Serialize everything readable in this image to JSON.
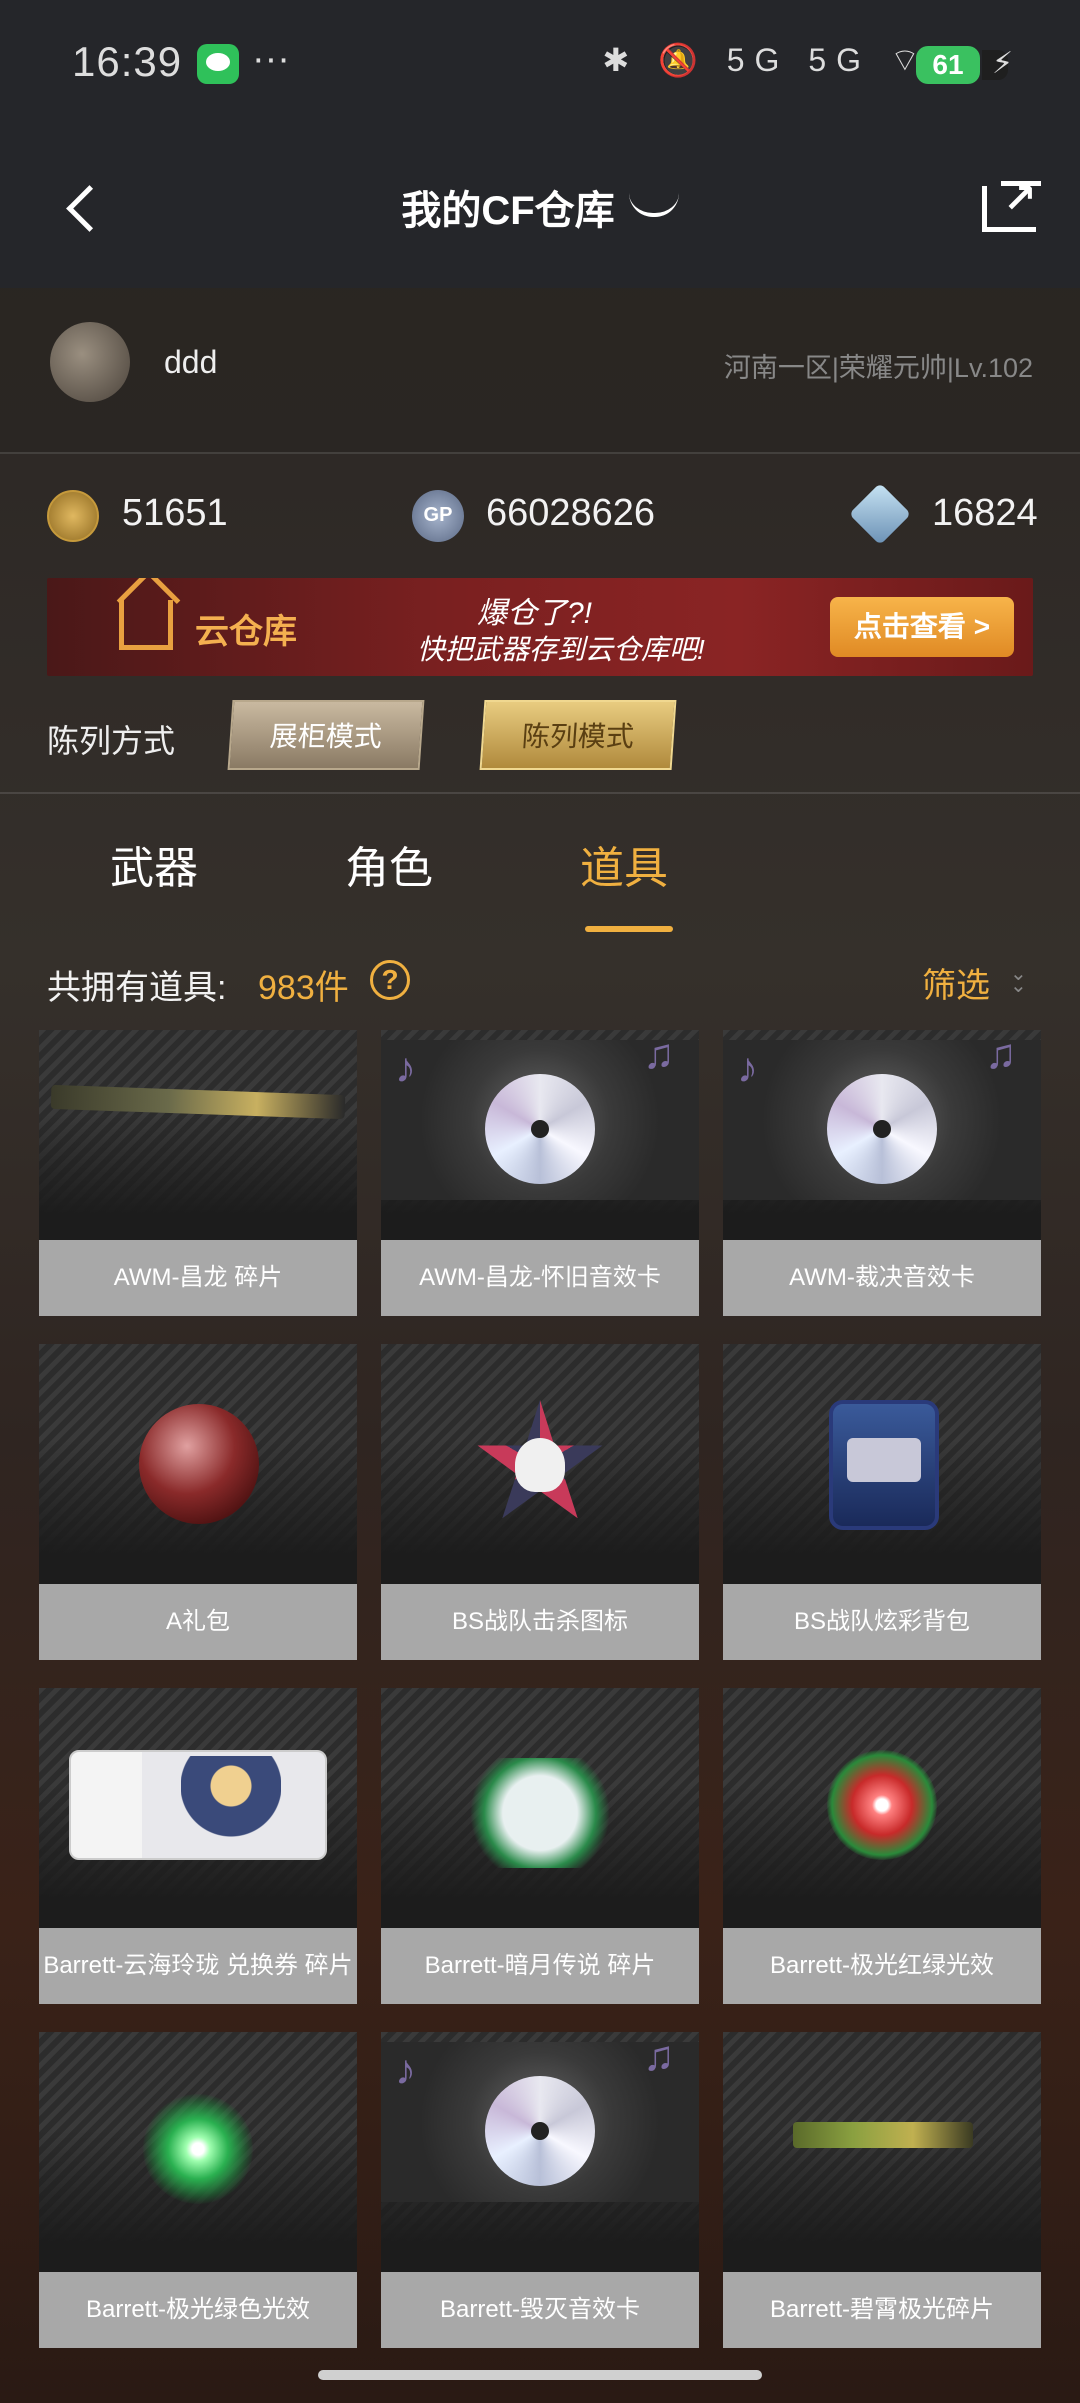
{
  "status_bar": {
    "time": "16:39",
    "extra": "···",
    "signal_icons": "✱ 🔕 5G 5G ⌔",
    "battery": "61"
  },
  "nav": {
    "title": "我的CF仓库",
    "back_icon": "chevron-left-icon",
    "share_icon": "share-icon"
  },
  "profile": {
    "username": "ddd",
    "server": "河南一区|荣耀元帅|Lv.102"
  },
  "currency": {
    "cf": "51651",
    "gp_icon_text": "GP",
    "gp": "66028626",
    "diamond": "16824"
  },
  "banner": {
    "title": "云仓库",
    "line1": "爆仓了?!",
    "line2": "快把武器存到云仓库吧!",
    "button": "点击查看 >"
  },
  "display": {
    "label": "陈列方式",
    "mode_showcase": "展柜模式",
    "mode_display": "陈列模式"
  },
  "tabs": [
    "武器",
    "角色",
    "道具"
  ],
  "active_tab": "道具",
  "count": {
    "label": "共拥有道具:",
    "value": "983件",
    "help": "?",
    "filter": "筛选"
  },
  "items": [
    {
      "name": "AWM-昌龙 碎片",
      "icon": "rifle-icon"
    },
    {
      "name": "AWM-昌龙-怀旧音效卡",
      "icon": "cd-icon"
    },
    {
      "name": "AWM-裁决音效卡",
      "icon": "cd-icon"
    },
    {
      "name": "A礼包",
      "icon": "orb-icon"
    },
    {
      "name": "BS战队击杀图标",
      "icon": "skull-star-icon"
    },
    {
      "name": "BS战队炫彩背包",
      "icon": "backpack-icon"
    },
    {
      "name": "Barrett-云海玲珑 兑换券 碎片",
      "icon": "ticket-icon"
    },
    {
      "name": "Barrett-暗月传说 碎片",
      "icon": "puzzle-icon"
    },
    {
      "name": "Barrett-极光红绿光效",
      "icon": "red-glow-icon"
    },
    {
      "name": "Barrett-极光绿色光效",
      "icon": "green-glow-icon"
    },
    {
      "name": "Barrett-毁灭音效卡",
      "icon": "cd-icon"
    },
    {
      "name": "Barrett-碧霄极光碎片",
      "icon": "rifle-icon"
    }
  ]
}
